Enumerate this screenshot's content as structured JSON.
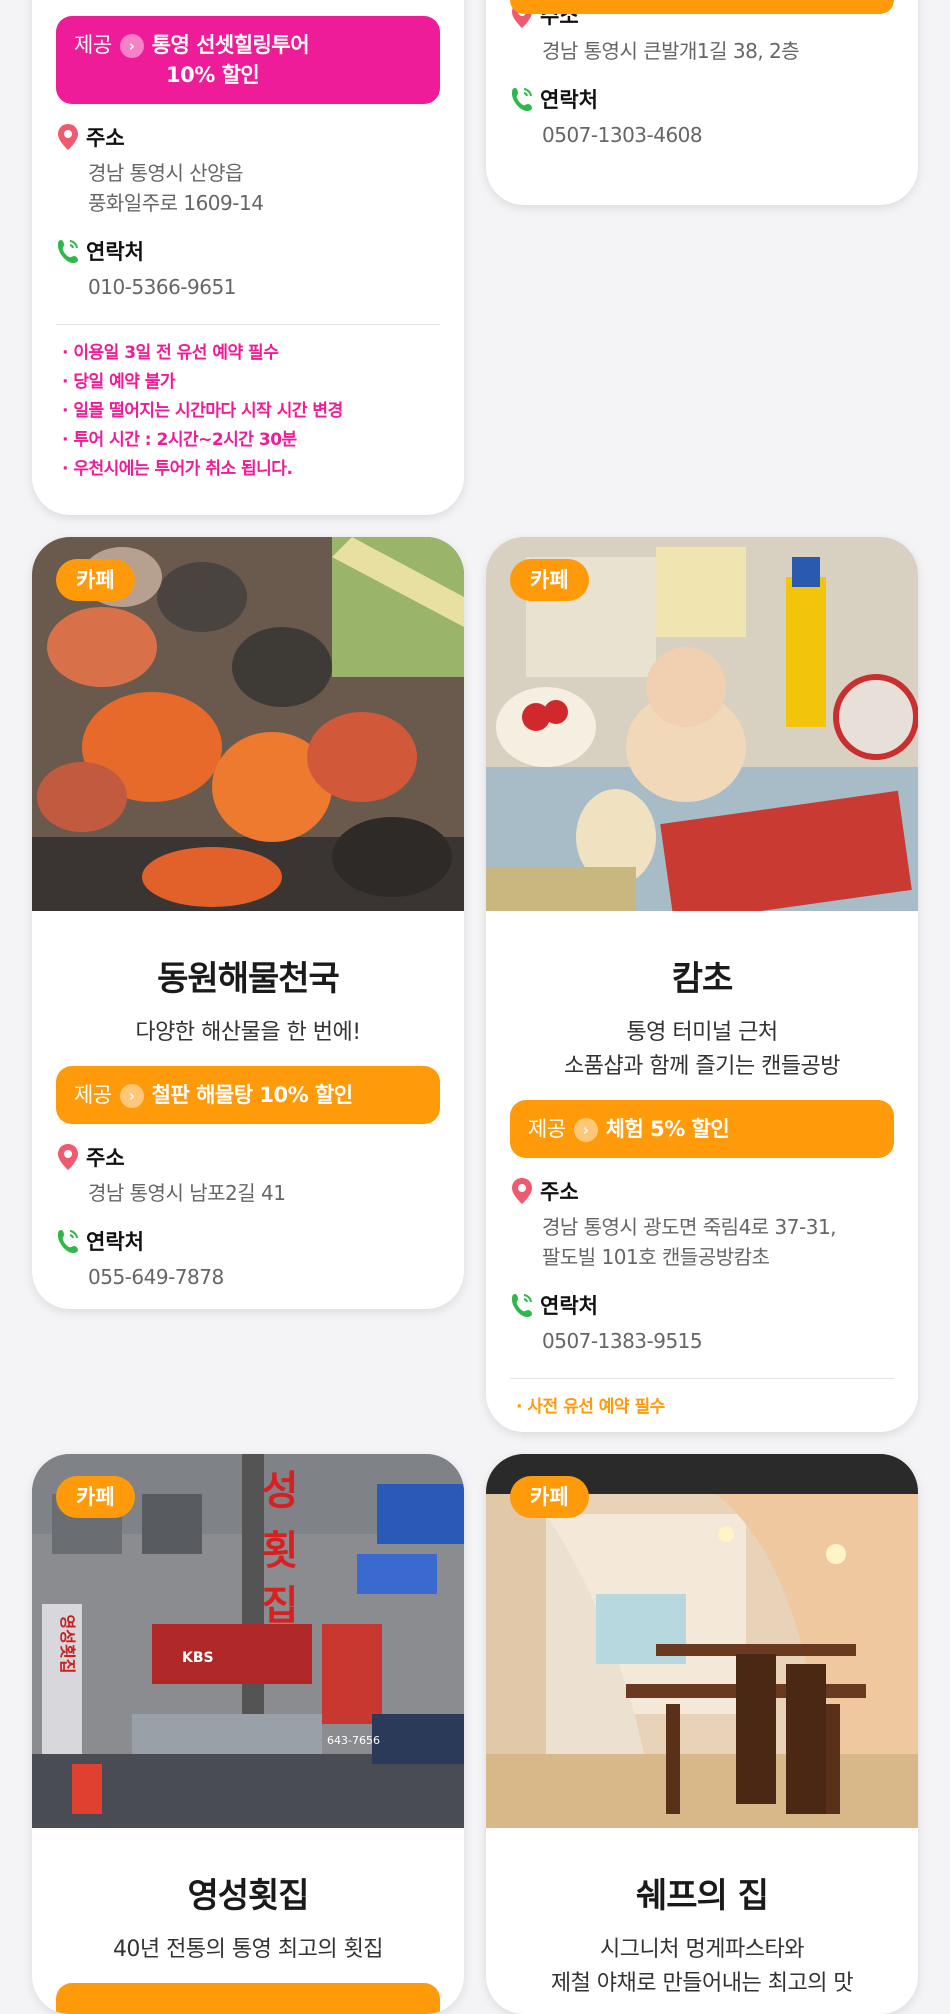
{
  "cards": {
    "c1": {
      "offer_label": "제공",
      "offer_text_line1": "통영 선셋힐링투어",
      "offer_text_line2": "10% 할인",
      "address_label": "주소",
      "address_line1": "경남 통영시 산양읍",
      "address_line2": "풍화일주로 1609-14",
      "contact_label": "연락처",
      "phone": "010-5366-9651",
      "notes": [
        "· 이용일 3일 전 유선 예약 필수",
        "· 당일 예약 불가",
        "· 일몰 떨어지는 시간마다 시작 시간 변경",
        "· 투어 시간 : 2시간~2시간 30분",
        "· 우천시에는 투어가 취소 됩니다."
      ]
    },
    "c2": {
      "address_label": "주소",
      "address_line1": "경남 통영시 큰발개1길 38, 2층",
      "contact_label": "연락처",
      "phone": "0507-1303-4608"
    },
    "c3": {
      "tag": "카페",
      "title": "동원해물천국",
      "desc_line1": "다양한 해산물을 한 번에!",
      "offer_label": "제공",
      "offer_text_line1": "철판 해물탕 10% 할인",
      "address_label": "주소",
      "address_line1": "경남 통영시 남포2길 41",
      "contact_label": "연락처",
      "phone": "055-649-7878"
    },
    "c4": {
      "tag": "카페",
      "title": "캄초",
      "desc_line1": "통영 터미널 근처",
      "desc_line2": "소품샵과 함께 즐기는 캔들공방",
      "offer_label": "제공",
      "offer_text_line1": "체험 5% 할인",
      "address_label": "주소",
      "address_line1": "경남 통영시 광도면 죽림4로 37-31,",
      "address_line2": "팔도빌 101호 캔들공방캄초",
      "contact_label": "연락처",
      "phone": "0507-1383-9515",
      "notes": [
        "· 사전 유선 예약 필수"
      ]
    },
    "c5": {
      "tag": "카페",
      "title": "영성횟집",
      "desc_line1": "40년 전통의 통영 최고의 횟집",
      "photo_sign_text": [
        "성",
        "횟",
        "집",
        "영성횟집",
        "KBS",
        "643-7656"
      ]
    },
    "c6": {
      "tag": "카페",
      "title": "쉐프의 집",
      "desc_line1": "시그니처 멍게파스타와",
      "desc_line2": "제철 야채로 만들어내는 최고의 맛"
    }
  },
  "colors": {
    "orange": "#ff9a0a",
    "pink": "#ee1c98"
  },
  "icons": {
    "address": "location-pin-icon",
    "contact": "phone-icon",
    "offer_arrow": "chevron-right-icon"
  }
}
